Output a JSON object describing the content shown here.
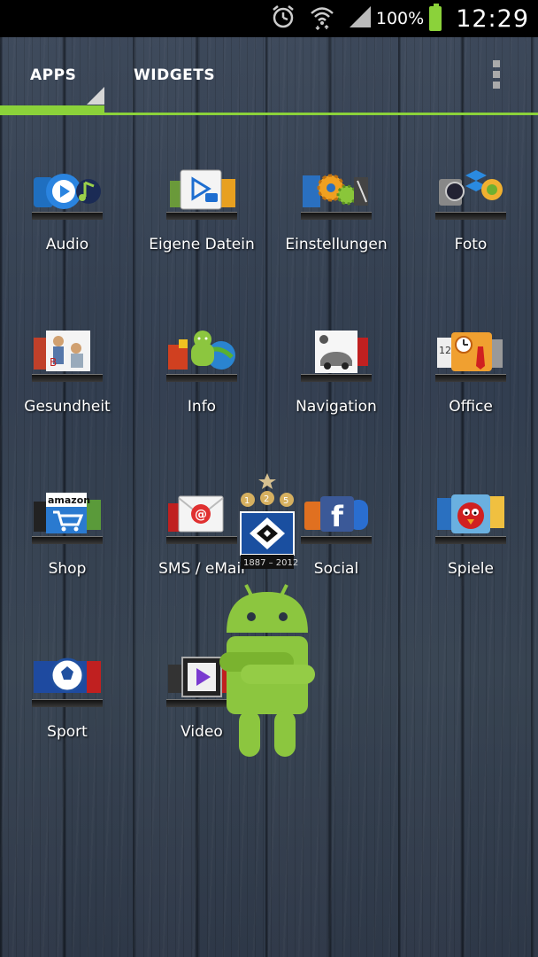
{
  "status_bar": {
    "battery_percent": "100%",
    "battery_level": 1.0,
    "time": "12:29",
    "icons": [
      "alarm-icon",
      "wifi-icon",
      "signal-icon",
      "battery-icon"
    ]
  },
  "tabs": [
    {
      "label": "APPS",
      "selected": true
    },
    {
      "label": "WIDGETS",
      "selected": false
    }
  ],
  "menu_icon": "overflow-menu-icon",
  "apps": [
    {
      "label": "Audio",
      "icon": "audio-folder-icon"
    },
    {
      "label": "Eigene Datein",
      "icon": "files-folder-icon"
    },
    {
      "label": "Einstellungen",
      "icon": "settings-folder-icon"
    },
    {
      "label": "Foto",
      "icon": "photo-folder-icon"
    },
    {
      "label": "Gesundheit",
      "icon": "health-folder-icon"
    },
    {
      "label": "Info",
      "icon": "info-folder-icon"
    },
    {
      "label": "Navigation",
      "icon": "navigation-folder-icon"
    },
    {
      "label": "Office",
      "icon": "office-folder-icon"
    },
    {
      "label": "Shop",
      "icon": "shop-folder-icon"
    },
    {
      "label": "SMS / eMail",
      "icon": "sms-email-folder-icon"
    },
    {
      "label": "Social",
      "icon": "social-folder-icon"
    },
    {
      "label": "Spiele",
      "icon": "games-folder-icon"
    },
    {
      "label": "Sport",
      "icon": "sport-folder-icon"
    },
    {
      "label": "Video",
      "icon": "video-folder-icon"
    }
  ],
  "overlay": {
    "hsv_logo_text": "1887 – 2012",
    "hsv_badges": [
      "1",
      "2",
      "5"
    ]
  },
  "colors": {
    "accent": "#8bd23a",
    "status_bg": "#000000",
    "text": "#ffffff"
  }
}
